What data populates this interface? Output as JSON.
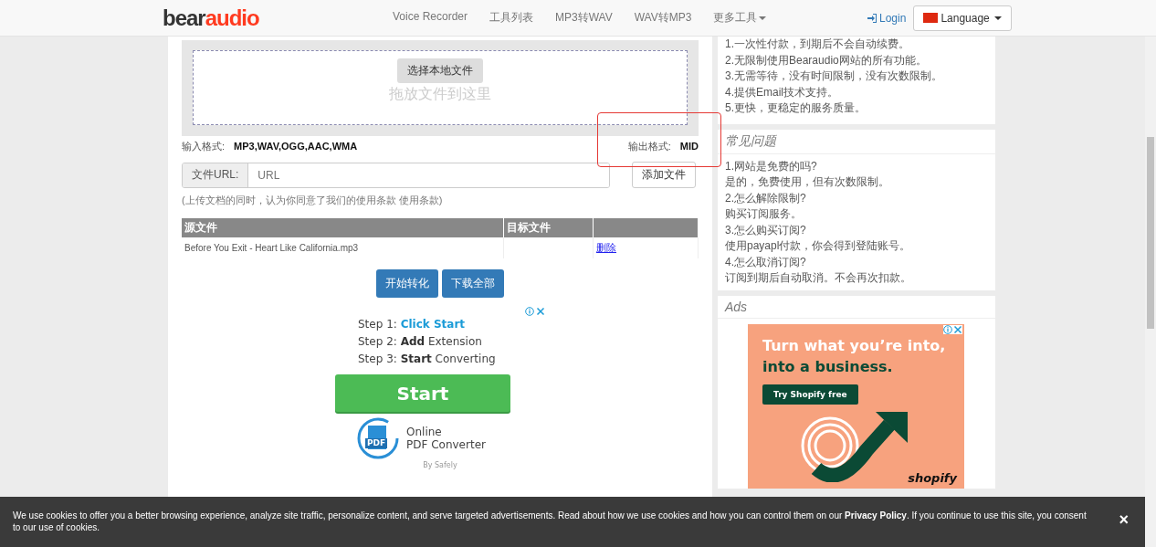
{
  "nav": {
    "logo_1": "bear",
    "logo_2": "audio",
    "links": [
      "Voice Recorder",
      "工具列表",
      "MP3转WAV",
      "WAV转MP3",
      "更多工具"
    ],
    "login": "Login",
    "language": "Language"
  },
  "upload": {
    "choose_button": "选择本地文件",
    "drop_hint": "拖放文件到这里",
    "input_label": "输入格式:",
    "input_value": "MP3,WAV,OGG,AAC,WMA",
    "output_label": "输出格式:",
    "output_value": "MID",
    "url_label": "文件URL:",
    "url_placeholder": "URL",
    "add_button": "添加文件",
    "note": "(上传文档的同时，认为你同意了我们的使用条款 使用条款)"
  },
  "table": {
    "columns": [
      "源文件",
      "目标文件"
    ],
    "rows": [
      {
        "source": "Before You Exit - Heart Like California.mp3",
        "action": "删除"
      }
    ]
  },
  "actions": [
    "开始转化",
    "下载全部"
  ],
  "ad_left": {
    "steps": [
      {
        "prefix": "Step 1:",
        "strong": "Click Start",
        "kind": "link"
      },
      {
        "prefix": "Step 2:",
        "strong": "Add",
        "rest": "Extension",
        "kind": "bold"
      },
      {
        "prefix": "Step 3:",
        "strong": "Start",
        "rest": "Converting",
        "kind": "bold"
      }
    ],
    "start_button": "Start",
    "pdf_label": "PDF",
    "product_1": "Online",
    "product_2": "PDF Converter",
    "by": "By Safely"
  },
  "sidebar": {
    "benefits": [
      "1.一次性付款，到期后不会自动续费。",
      "2.无限制使用Bearaudio网站的所有功能。",
      "3.无需等待，没有时间限制，没有次数限制。",
      "4.提供Email技术支持。",
      "5.更快，更稳定的服务质量。"
    ],
    "faq_title": "常见问题",
    "faq": [
      {
        "q": "1.网站是免费的吗?",
        "a": "是的，免费使用，但有次数限制。"
      },
      {
        "q": "2.怎么解除限制?",
        "a": "购买订阅服务。"
      },
      {
        "q": "3.怎么购买订阅?",
        "a": "使用payapl付款，你会得到登陆账号。"
      },
      {
        "q": "4.怎么取消订阅?",
        "a": "订阅到期后自动取消。不会再次扣款。"
      }
    ],
    "ads_title": "Ads",
    "ad": {
      "headline_1": "Turn what you’re into,",
      "headline_2": "into a business.",
      "cta": "Try Shopify free",
      "brand": "shopify"
    }
  },
  "cookie": {
    "text": "We use cookies to offer you a better browsing experience, analyze site traffic, personalize content, and serve targeted advertisements. Read about how we use cookies and how you can control them on our **Privacy Policy**. If you continue to use this site, you consent to our use of cookies.",
    "close": "×"
  }
}
